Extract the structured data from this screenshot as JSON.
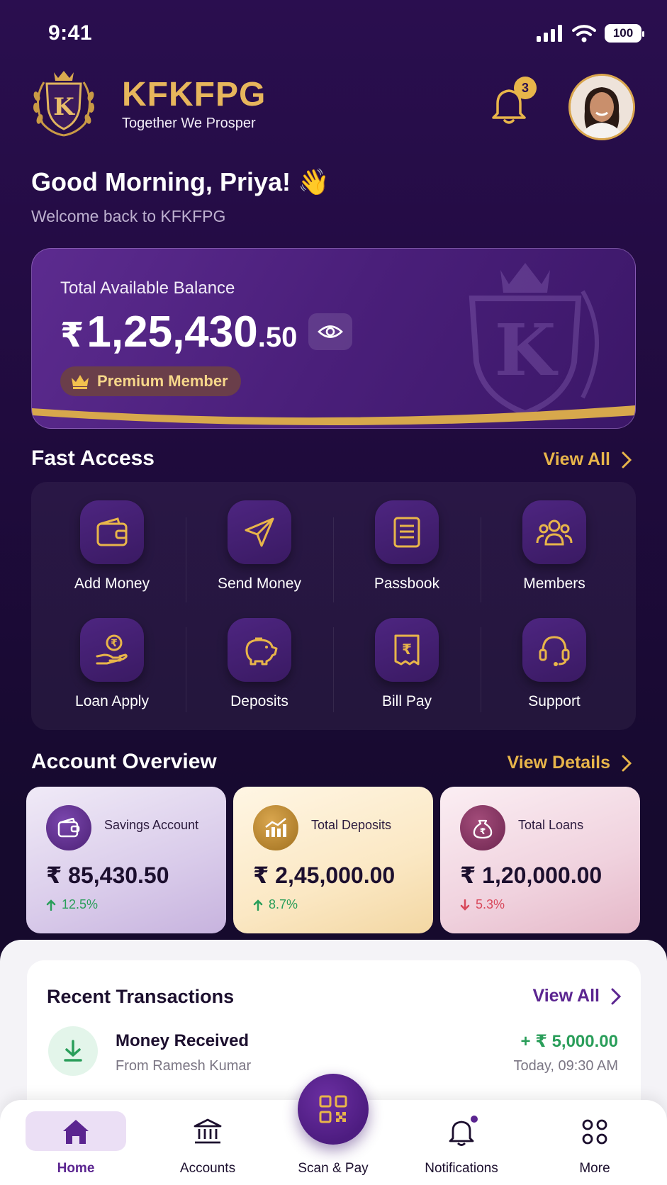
{
  "status_bar": {
    "time": "9:41",
    "battery": "100"
  },
  "header": {
    "brand_name": "KFKFPG",
    "tagline": "Together We Prosper",
    "logo_letter": "K",
    "notification_count": "3"
  },
  "greeting": {
    "title": "Good Morning, Priya! 👋",
    "subtitle": "Welcome back to KFKFPG"
  },
  "balance": {
    "label": "Total Available Balance",
    "currency": "₹",
    "amount_main": "1,25,430",
    "amount_decimal": ".50",
    "badge": "Premium Member",
    "watermark_letter": "K"
  },
  "fast_access": {
    "title": "Fast Access",
    "view_all": "View All",
    "items": [
      {
        "label": "Add Money",
        "icon": "wallet-icon"
      },
      {
        "label": "Send Money",
        "icon": "send-icon"
      },
      {
        "label": "Passbook",
        "icon": "passbook-icon"
      },
      {
        "label": "Members",
        "icon": "members-icon"
      },
      {
        "label": "Loan Apply",
        "icon": "loan-hand-icon"
      },
      {
        "label": "Deposits",
        "icon": "piggy-bank-icon"
      },
      {
        "label": "Bill Pay",
        "icon": "bill-icon"
      },
      {
        "label": "Support",
        "icon": "headset-icon"
      }
    ]
  },
  "account_overview": {
    "title": "Account Overview",
    "view_details": "View Details",
    "cards": [
      {
        "title": "Savings Account",
        "amount": "₹ 85,430.50",
        "change": "12.5%",
        "trend": "up",
        "icon": "wallet-icon"
      },
      {
        "title": "Total Deposits",
        "amount": "₹ 2,45,000.00",
        "change": "8.7%",
        "trend": "up",
        "icon": "growth-chart-icon"
      },
      {
        "title": "Total Loans",
        "amount": "₹ 1,20,000.00",
        "change": "5.3%",
        "trend": "down",
        "icon": "money-bag-icon"
      }
    ]
  },
  "recent_transactions": {
    "title": "Recent Transactions",
    "view_all": "View All",
    "items": [
      {
        "name": "Money Received",
        "detail": "From Ramesh Kumar",
        "amount": "+ ₹ 5,000.00",
        "time": "Today, 09:30 AM",
        "icon": "download-arrow-icon"
      }
    ]
  },
  "bottom_nav": {
    "items": [
      {
        "label": "Home",
        "icon": "home-icon",
        "active": true
      },
      {
        "label": "Accounts",
        "icon": "bank-icon"
      },
      {
        "label": "Scan & Pay",
        "icon": "qr-code-icon"
      },
      {
        "label": "Notifications",
        "icon": "bell-icon"
      },
      {
        "label": "More",
        "icon": "more-grid-icon"
      }
    ]
  },
  "colors": {
    "background": "#200b3e",
    "gold": "#e8b54a",
    "purple_accent": "#5b2590",
    "positive": "#2a9e5a",
    "negative": "#d8485b"
  }
}
